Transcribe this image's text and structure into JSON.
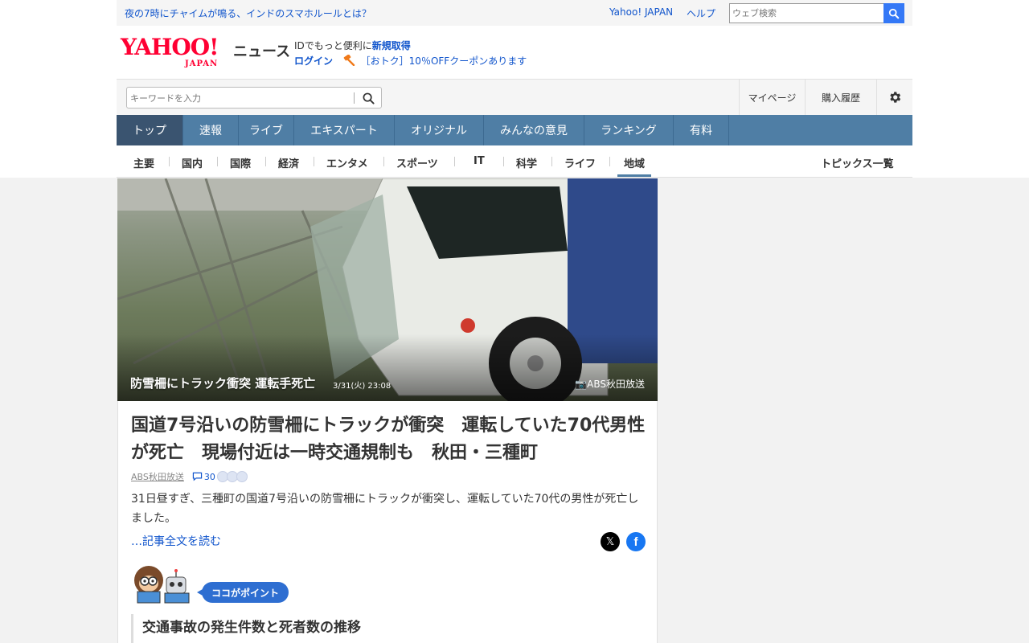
{
  "topbar": {
    "promo": "夜の7時にチャイムが鳴る、インドのスマホルールとは？",
    "yahoo_japan": "Yahoo! JAPAN",
    "help": "ヘルプ",
    "web_search_placeholder": "ウェブ検索"
  },
  "header": {
    "logo_main": "YAHOO!",
    "logo_sub": "JAPAN",
    "section": "ニュース",
    "id_text": "IDでもっと便利に",
    "id_link": "新規取得",
    "login": "ログイン",
    "coupon": "［おトク］10％OFFクーポンあります"
  },
  "search": {
    "placeholder": "キーワードを入力",
    "mypage": "マイページ",
    "history": "購入履歴"
  },
  "global_nav": [
    "トップ",
    "速報",
    "ライブ",
    "エキスパート",
    "オリジナル",
    "みんなの意見",
    "ランキング",
    "有料"
  ],
  "category_nav": [
    "主要",
    "国内",
    "国際",
    "経済",
    "エンタメ",
    "スポーツ",
    "IT",
    "科学",
    "ライフ",
    "地域"
  ],
  "topics_all": "トピックス一覧",
  "hero": {
    "caption": "防雪柵にトラック衝突 運転手死亡",
    "date": "3/31(火) 23:08",
    "source": "ABS秋田放送"
  },
  "article": {
    "title": "国道7号沿いの防雪柵にトラックが衝突　運転していた70代男性が死亡　現場付近は一時交通規制も　秋田・三種町",
    "source": "ABS秋田放送",
    "comments": "30",
    "body": "31日昼すぎ、三種町の国道7号沿いの防雪柵にトラックが衝突し、運転していた70代の男性が死亡しました。",
    "read_more": "…記事全文を読む",
    "point_label": "ココがポイント",
    "point_heading": "交通事故の発生件数と死者数の推移"
  },
  "colors": {
    "nav_blue": "#4f7ea5",
    "nav_active": "#3a5470",
    "link": "#1155cc",
    "logo_red": "#ff0033"
  }
}
